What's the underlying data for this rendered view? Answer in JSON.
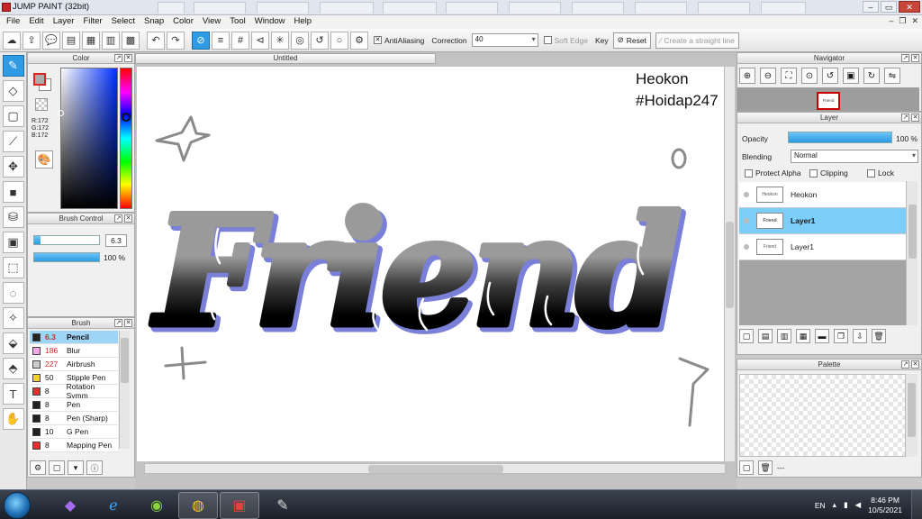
{
  "window": {
    "title": "JUMP PAINT (32bit)"
  },
  "menu": [
    "File",
    "Edit",
    "Layer",
    "Filter",
    "Select",
    "Snap",
    "Color",
    "View",
    "Tool",
    "Window",
    "Help"
  ],
  "toolbar": {
    "antialiasing_label": "AntiAliasing",
    "correction_label": "Correction",
    "correction_value": "40",
    "soft_edge_label": "Soft Edge",
    "key_label": "Key",
    "reset_label": "Reset",
    "straight_line_label": "Create a straight line"
  },
  "color_panel": {
    "title": "Color",
    "r": "R:172",
    "g": "G:172",
    "b": "B:172",
    "fg_color": "#acacac"
  },
  "brush_control": {
    "title": "Brush Control",
    "size_value": "6.3",
    "opacity_value": "100 %",
    "size_fraction": 0.1,
    "opacity_fraction": 1.0
  },
  "brush_panel": {
    "title": "Brush",
    "items": [
      {
        "size": "6.3",
        "name": "Pencil",
        "color": "#222222",
        "selected": true,
        "red": true
      },
      {
        "size": "186",
        "name": "Blur",
        "color": "#f4a8e8",
        "selected": false,
        "red": true
      },
      {
        "size": "227",
        "name": "Airbrush",
        "color": "#cccccc",
        "selected": false,
        "red": true
      },
      {
        "size": "50",
        "name": "Stipple Pen",
        "color": "#f3d51c",
        "selected": false,
        "red": false
      },
      {
        "size": "8",
        "name": "Rotation Symm",
        "color": "#e52f2f",
        "selected": false,
        "red": false
      },
      {
        "size": "8",
        "name": "Pen",
        "color": "#222222",
        "selected": false,
        "red": false
      },
      {
        "size": "8",
        "name": "Pen (Sharp)",
        "color": "#222222",
        "selected": false,
        "red": false
      },
      {
        "size": "10",
        "name": "G Pen",
        "color": "#222222",
        "selected": false,
        "red": false
      },
      {
        "size": "8",
        "name": "Mapping Pen",
        "color": "#e52f2f",
        "selected": false,
        "red": false
      }
    ]
  },
  "canvas": {
    "tab_label": "Untitled",
    "artwork_text": "Friend",
    "watermark_line1": "Heokon",
    "watermark_line2": "#Hoidap247"
  },
  "navigator": {
    "title": "Navigator",
    "preview_text": "Friend"
  },
  "layer_panel": {
    "title": "Layer",
    "opacity_label": "Opacity",
    "opacity_value": "100 %",
    "opacity_fraction": 1.0,
    "blending_label": "Blending",
    "blending_value": "Normal",
    "protect_alpha_label": "Protect Alpha",
    "clipping_label": "Clipping",
    "lock_label": "Lock",
    "layers": [
      {
        "name": "Heokon",
        "thumb": "Heokon #Hoidap247",
        "selected": false
      },
      {
        "name": "Layer1",
        "thumb": "Friend",
        "selected": true
      },
      {
        "name": "Layer1",
        "thumb": "Friend",
        "selected": false
      }
    ]
  },
  "palette_panel": {
    "title": "Palette",
    "footer_text": "---"
  },
  "taskbar": {
    "language": "EN",
    "time": "8:46 PM",
    "date": "10/5/2021"
  },
  "colors": {
    "accent": "#2f9be4",
    "selection": "#7ccdf7",
    "artwork_outline": "#7a80d8"
  }
}
